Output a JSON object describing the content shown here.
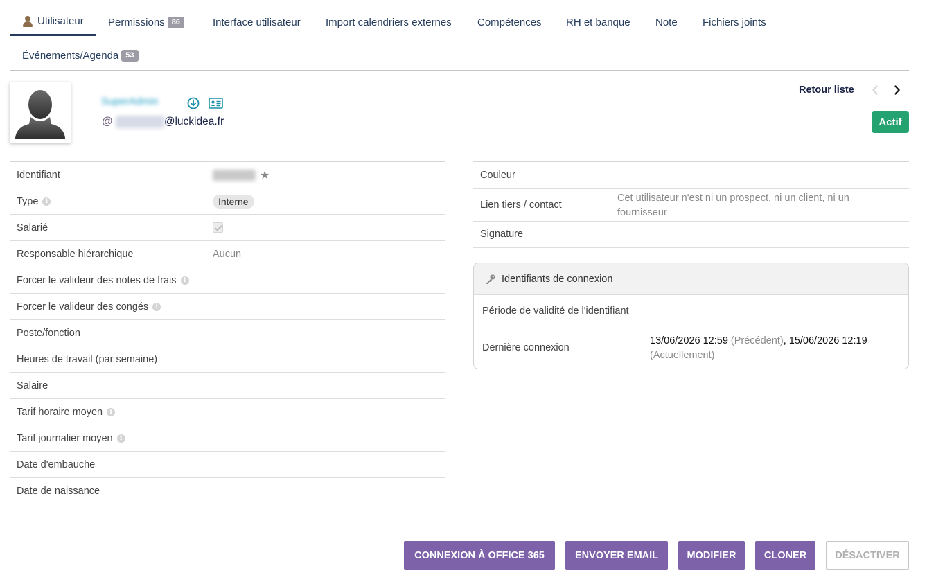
{
  "tabs": [
    {
      "label": "Utilisateur",
      "badge": null,
      "active": true
    },
    {
      "label": "Permissions",
      "badge": "86"
    },
    {
      "label": "Interface utilisateur",
      "badge": null
    },
    {
      "label": "Import calendriers externes",
      "badge": null
    },
    {
      "label": "Compétences",
      "badge": null
    },
    {
      "label": "RH et banque",
      "badge": null
    },
    {
      "label": "Note",
      "badge": null
    },
    {
      "label": "Fichiers joints",
      "badge": null
    },
    {
      "label": "Événements/Agenda",
      "badge": "53"
    }
  ],
  "header": {
    "username": "SuperAdmin",
    "email_at": "@",
    "email_domain": "@luckidea.fr",
    "back_label": "Retour liste",
    "prev_icon": "chevron-left-icon",
    "next_icon": "chevron-right-icon",
    "status": "Actif",
    "status_color": "#24a26f"
  },
  "left_fields": [
    {
      "label": "Identifiant",
      "value": "",
      "info": false
    },
    {
      "label": "Type",
      "value": "Interne",
      "info": true
    },
    {
      "label": "Salarié",
      "value": "",
      "info": false
    },
    {
      "label": "Responsable hiérarchique",
      "value": "Aucun",
      "info": false
    },
    {
      "label": "Forcer le valideur des notes de frais",
      "value": "",
      "info": true
    },
    {
      "label": "Forcer le valideur des congés",
      "value": "",
      "info": true
    },
    {
      "label": "Poste/fonction",
      "value": "",
      "info": false
    },
    {
      "label": "Heures de travail (par semaine)",
      "value": "",
      "info": false
    },
    {
      "label": "Salaire",
      "value": "",
      "info": false
    },
    {
      "label": "Tarif horaire moyen",
      "value": "",
      "info": true
    },
    {
      "label": "Tarif journalier moyen",
      "value": "",
      "info": true
    },
    {
      "label": "Date d'embauche",
      "value": "",
      "info": false
    },
    {
      "label": "Date de naissance",
      "value": "",
      "info": false
    }
  ],
  "right_fields": [
    {
      "label": "Couleur",
      "value": ""
    },
    {
      "label": "Lien tiers / contact",
      "value": "Cet utilisateur n'est ni un prospect, ni un client, ni un fournisseur"
    },
    {
      "label": "Signature",
      "value": ""
    }
  ],
  "login": {
    "title": "Identifiants de connexion",
    "validity_label": "Période de validité de l'identifiant",
    "last_label": "Dernière connexion",
    "last_date1": "13/06/2026 12:59",
    "last_prev": " (Précédent)",
    "last_sep": ", ",
    "last_date2": "15/06/2026 12:19",
    "last_current": "(Actuellement)"
  },
  "buttons": {
    "office": "CONNEXION À OFFICE 365",
    "email": "ENVOYER EMAIL",
    "modify": "MODIFIER",
    "clone": "CLONER",
    "deactivate": "DÉSACTIVER",
    "accent": "#7e62a9"
  }
}
